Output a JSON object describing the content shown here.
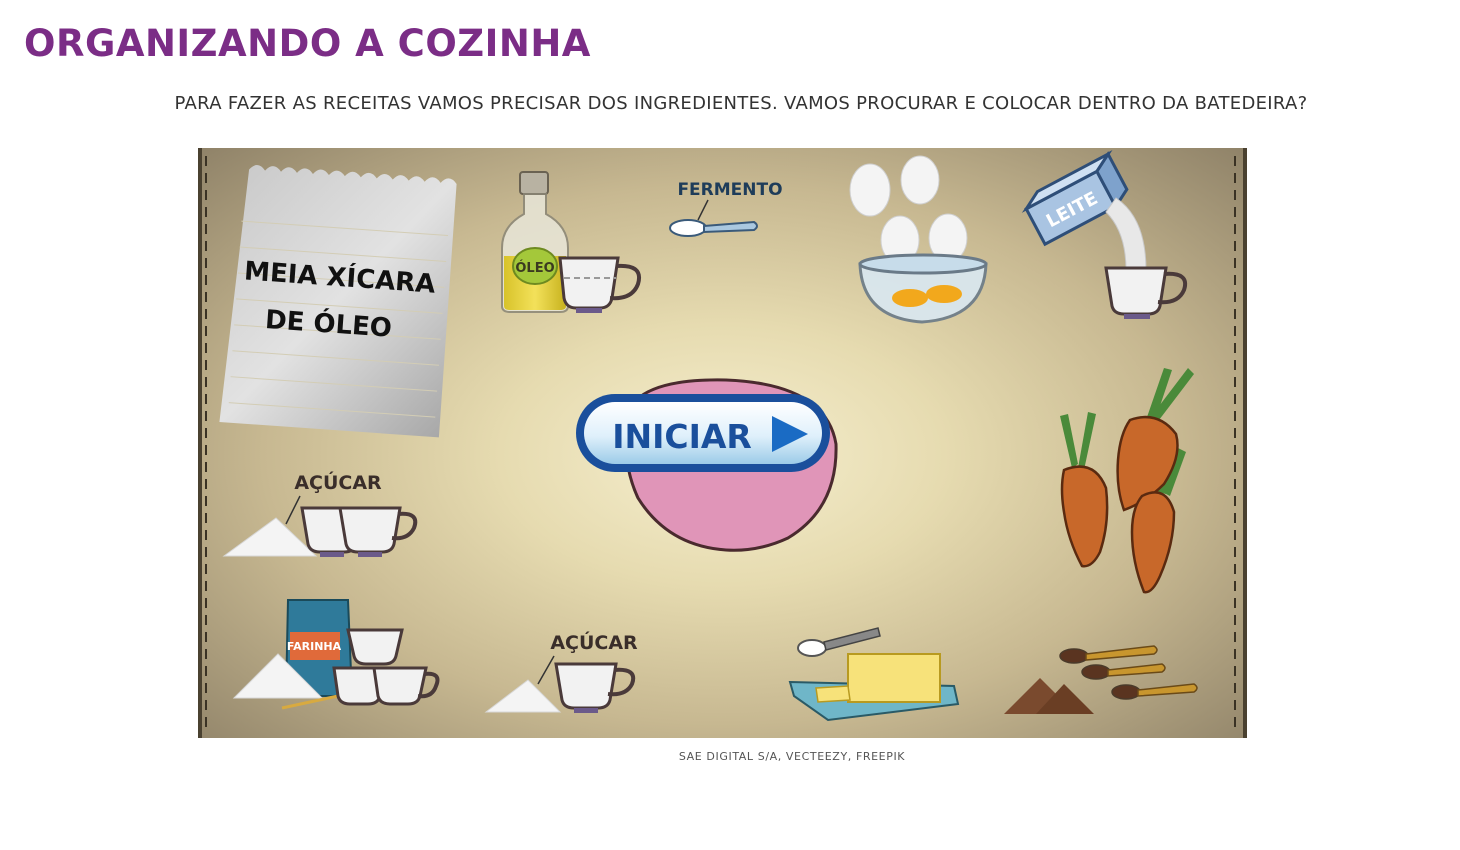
{
  "page": {
    "title": "ORGANIZANDO A COZINHA",
    "instruction": "PARA FAZER AS RECEITAS VAMOS PRECISAR DOS INGREDIENTES. VAMOS PROCURAR E COLOCAR DENTRO DA BATEDEIRA?",
    "credit": "SAE DIGITAL S/A, VECTEEZY, FREEPIK"
  },
  "game": {
    "note_line1": "MEIA XÍCARA",
    "note_line2": "DE ÓLEO",
    "start_button": "INICIAR",
    "labels": {
      "oil": "ÓLEO",
      "yeast": "FERMENTO",
      "milk": "LEITE",
      "sugar_top": "AÇÚCAR",
      "sugar_bottom": "AÇÚCAR",
      "flour": "FARINHA"
    }
  },
  "colors": {
    "title": "#7b2d86",
    "bowl": "#e095b8",
    "button_blue": "#1a4f9c",
    "carrot": "#c8682a"
  },
  "icons": [
    "oil-bottle-icon",
    "measuring-cup-icon",
    "yeast-spoon-icon",
    "egg-bowl-icon",
    "milk-carton-icon",
    "carrots-icon",
    "sugar-pile-icon",
    "flour-bag-icon",
    "butter-dish-icon",
    "cocoa-spoons-icon",
    "mixing-bowl-icon",
    "play-icon"
  ]
}
